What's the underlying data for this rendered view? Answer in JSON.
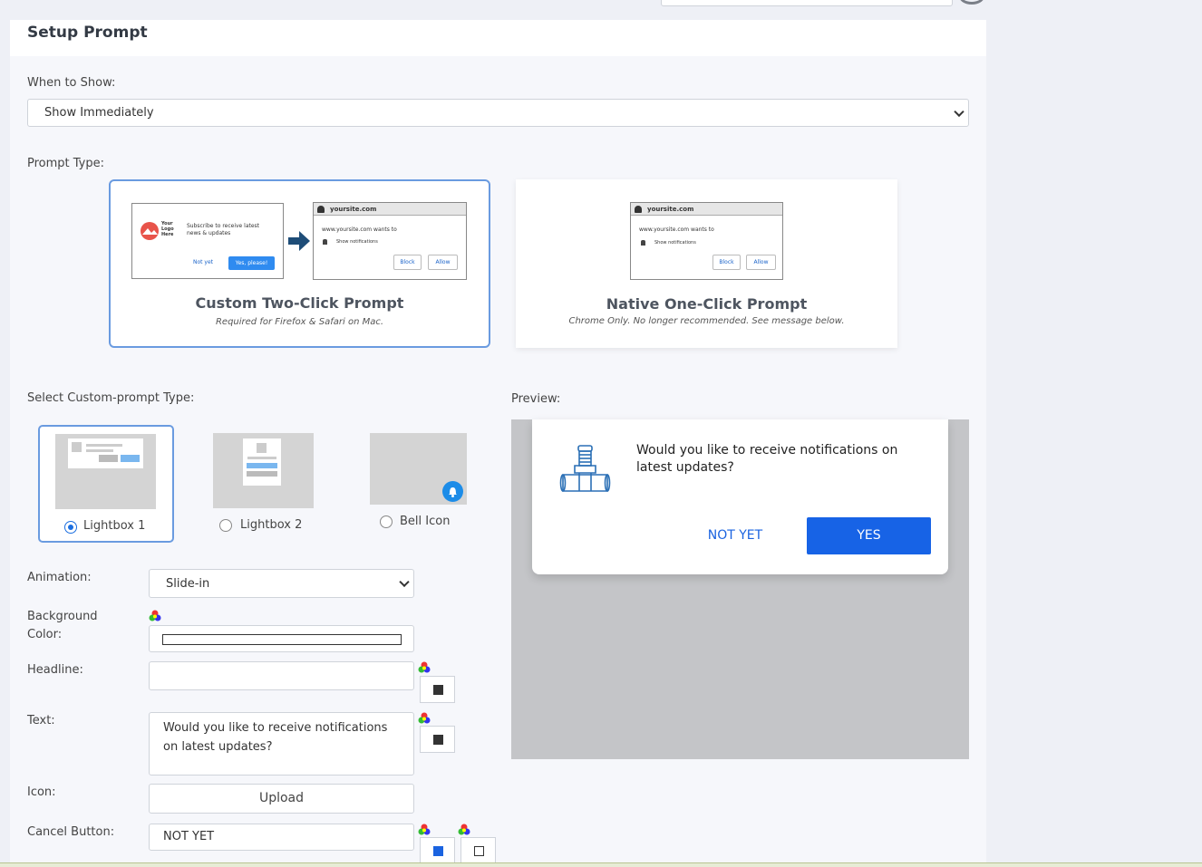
{
  "page": {
    "title": "Setup Prompt"
  },
  "when_to_show": {
    "label": "When to Show:",
    "value": "Show Immediately"
  },
  "prompt_type": {
    "label": "Prompt Type:",
    "custom": {
      "title": "Custom Two-Click Prompt",
      "subtitle": "Required for Firefox & Safari on Mac.",
      "mock_logo": "Your Logo Here",
      "mock_text": "Subscribe to receive latest news & updates",
      "mock_not_yet": "Not yet",
      "mock_yes": "Yes, please!"
    },
    "native": {
      "title": "Native One-Click Prompt",
      "subtitle": "Chrome Only. No longer recommended. See message below."
    },
    "mock_site": "yoursite.com",
    "mock_wants": "www.yoursite.com wants to",
    "mock_show": "Show notifications",
    "mock_block": "Block",
    "mock_allow": "Allow"
  },
  "custom_prompt_type": {
    "label": "Select Custom-prompt Type:",
    "options": [
      {
        "label": "Lightbox 1",
        "selected": true
      },
      {
        "label": "Lightbox 2",
        "selected": false
      },
      {
        "label": "Bell Icon",
        "selected": false
      }
    ]
  },
  "form": {
    "animation_label": "Animation:",
    "animation_value": "Slide-in",
    "background_label": "Background Color:",
    "headline_label": "Headline:",
    "headline_value": "",
    "text_label": "Text:",
    "text_value": "Would you like to receive notifications on latest updates?",
    "icon_label": "Icon:",
    "upload_label": "Upload",
    "cancel_label": "Cancel Button:",
    "cancel_value": "NOT YET"
  },
  "colors": {
    "headline_text": "#333333",
    "body_text": "#333333",
    "cancel_text": "#1a63e0",
    "cancel_bg": "#ffffff"
  },
  "preview": {
    "label": "Preview:",
    "message": "Would you like to receive notifications on latest updates?",
    "not_yet": "NOT YET",
    "yes": "YES",
    "icon": "faucet-pipe-icon"
  }
}
